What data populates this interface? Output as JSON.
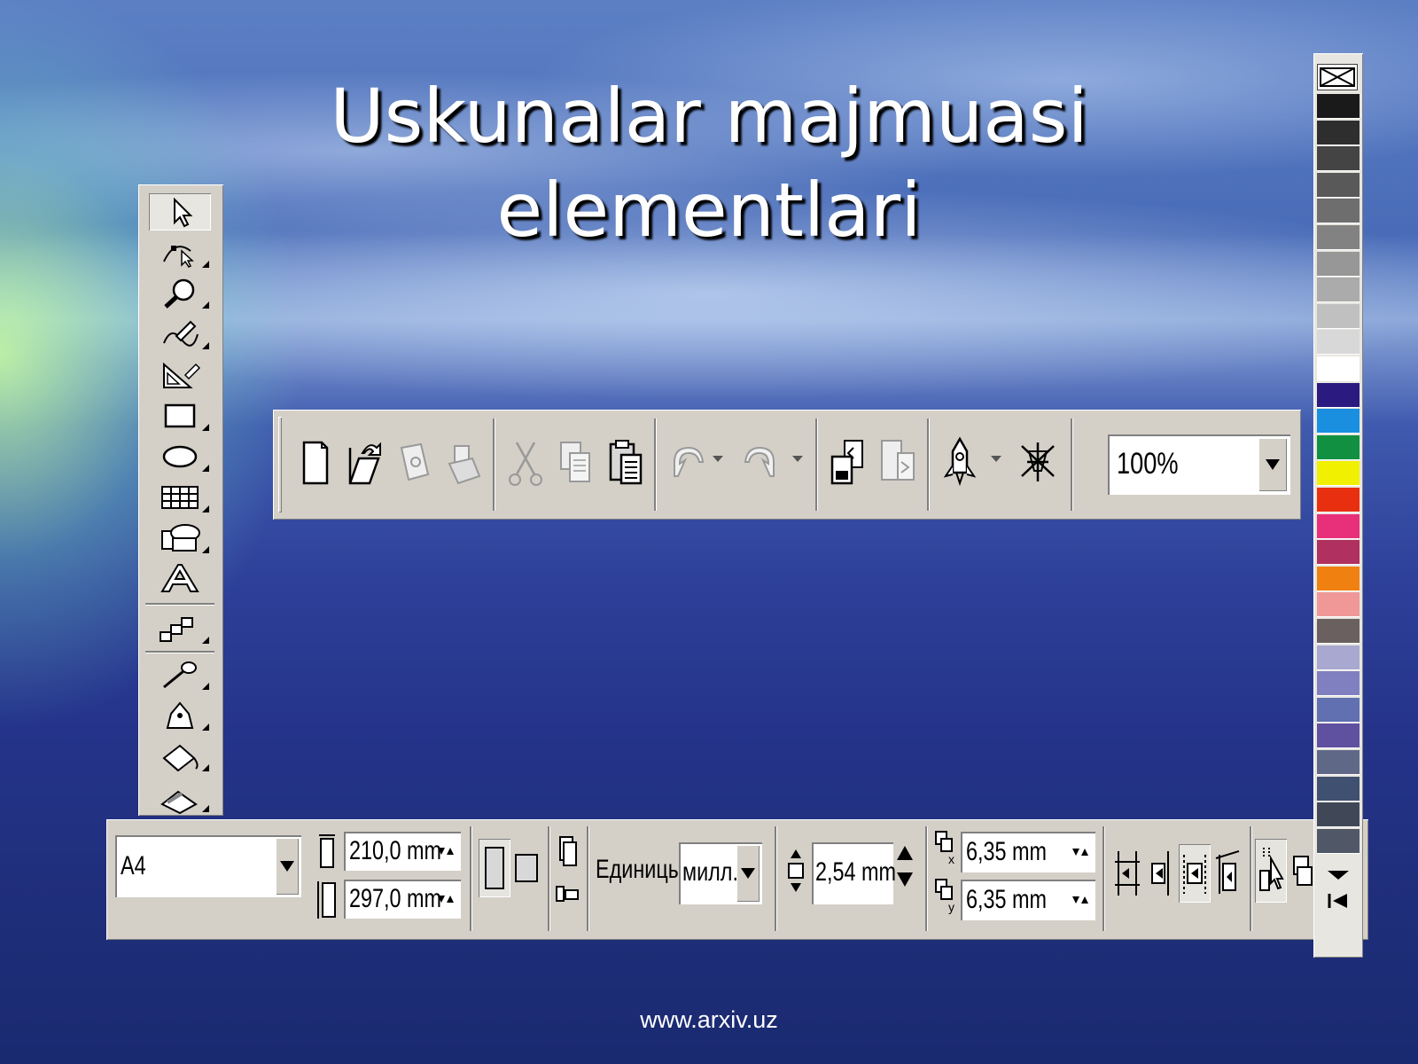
{
  "slide": {
    "title_line1": "Uskunalar  majmuasi",
    "title_line2": "elementlari",
    "footer": "www.arxiv.uz"
  },
  "toolbox": {
    "tools": [
      {
        "name": "pick-tool",
        "icon": "arrow-pointer-icon",
        "flyout": false,
        "selected": true
      },
      {
        "name": "shape-tool",
        "icon": "node-edit-icon",
        "flyout": true
      },
      {
        "name": "zoom-tool",
        "icon": "magnifier-icon",
        "flyout": true
      },
      {
        "name": "freehand-tool",
        "icon": "pencil-curve-icon",
        "flyout": true
      },
      {
        "name": "smart-fill-tool",
        "icon": "triangle-ruler-icon",
        "flyout": true
      },
      {
        "name": "rectangle-tool",
        "icon": "rectangle-icon",
        "flyout": true
      },
      {
        "name": "ellipse-tool",
        "icon": "ellipse-icon",
        "flyout": true
      },
      {
        "name": "graph-paper-tool",
        "icon": "grid-table-icon",
        "flyout": true
      },
      {
        "name": "basic-shapes-tool",
        "icon": "shapes-icon",
        "flyout": true
      },
      {
        "name": "text-tool",
        "icon": "letter-a-icon",
        "flyout": false
      },
      {
        "name": "interactive-blend-tool",
        "icon": "blend-steps-icon",
        "flyout": true
      },
      {
        "name": "eyedropper-tool",
        "icon": "eyedropper-icon",
        "flyout": true
      },
      {
        "name": "outline-tool",
        "icon": "pen-nib-icon",
        "flyout": true
      },
      {
        "name": "fill-tool",
        "icon": "paint-bucket-icon",
        "flyout": true
      },
      {
        "name": "interactive-fill-tool",
        "icon": "interactive-fill-icon",
        "flyout": true
      }
    ]
  },
  "standard_toolbar": {
    "buttons": [
      "new-document-icon",
      "open-icon",
      "save-icon",
      "print-icon",
      "cut-icon",
      "copy-icon",
      "paste-icon",
      "undo-icon",
      "redo-icon",
      "import-icon",
      "export-icon",
      "application-launcher-icon",
      "corel-online-icon"
    ],
    "zoom_value": "100%"
  },
  "property_bar": {
    "paper_type": "A4",
    "width": "210,0 mm",
    "height": "297,0 mm",
    "units_label": "Единицы:",
    "units_value": "милл...",
    "nudge": "2,54 mm",
    "dup_x": "6,35 mm",
    "dup_y": "6,35 mm"
  },
  "palette": {
    "no_color_icon": "no-color-x-icon",
    "colors": [
      "#1a1a1a",
      "#2e2e2e",
      "#444444",
      "#595959",
      "#6e6e6e",
      "#828282",
      "#979797",
      "#ababab",
      "#c0c0c0",
      "#d8d8d8",
      "#ffffff",
      "#2b1a80",
      "#1a8fe0",
      "#109040",
      "#f0f000",
      "#e83010",
      "#e8307a",
      "#b03060",
      "#f08010",
      "#f09898",
      "#6a6060",
      "#a8a8d0",
      "#8080c0",
      "#6070b0",
      "#6050a0",
      "#606888",
      "#405070",
      "#404858",
      "#505868"
    ]
  }
}
